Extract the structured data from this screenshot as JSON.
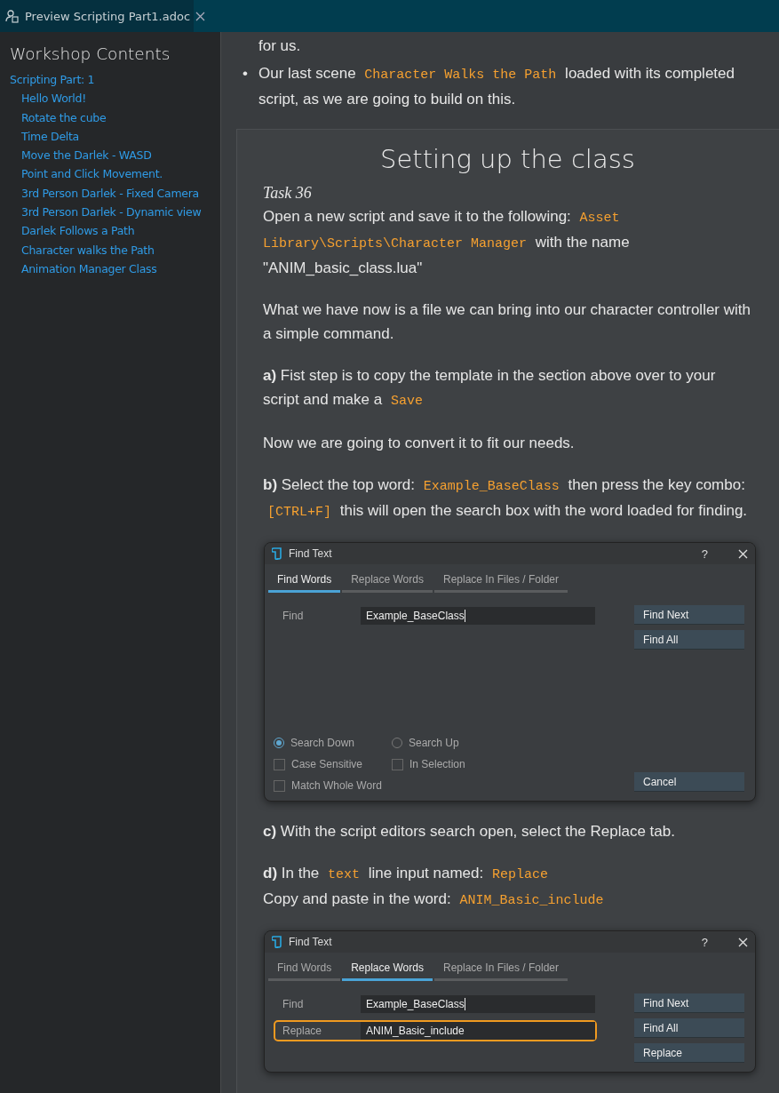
{
  "tab": {
    "title": "Preview Scripting Part1.adoc"
  },
  "sidebar": {
    "title": "Workshop Contents",
    "items": [
      {
        "label": "Scripting Part: 1",
        "children": [
          {
            "label": "Hello World!"
          },
          {
            "label": "Rotate the cube"
          },
          {
            "label": "Time Delta"
          },
          {
            "label": "Move the Darlek - WASD"
          },
          {
            "label": "Point and Click Movement."
          },
          {
            "label": "3rd Person Darlek - Fixed Camera"
          },
          {
            "label": "3rd Person Darlek - Dynamic view"
          },
          {
            "label": "Darlek Follows a Path"
          },
          {
            "label": "Character walks the Path"
          },
          {
            "label": "Animation Manager Class"
          }
        ]
      }
    ]
  },
  "intro_text": "for us.",
  "bullets": [
    {
      "marker": "•",
      "segments": [
        {
          "kind": "text",
          "text": "Our last scene "
        },
        {
          "kind": "code",
          "text": "Character Walks the Path"
        },
        {
          "kind": "text",
          "text": " loaded with its completed script, as we are going to build on this."
        }
      ]
    }
  ],
  "section": {
    "title": "Setting up the class",
    "task_label": "Task 36",
    "blocks": [
      {
        "kind": "paragraph",
        "segments": [
          {
            "kind": "text",
            "text": "Open a new script and save it to the following: "
          },
          {
            "kind": "code",
            "text": "Asset Library\\Scripts\\Character Manager"
          },
          {
            "kind": "text",
            "text": " with the name \"ANIM_basic_class.lua\""
          }
        ]
      },
      {
        "kind": "paragraph",
        "segments": [
          {
            "kind": "text",
            "text": "What we have now is a file we can bring into our character controller with a simple command."
          }
        ]
      },
      {
        "kind": "paragraph",
        "segments": [
          {
            "kind": "text",
            "text": "**a)** Fist step is to copy the template in the section above over to your script and make a "
          },
          {
            "kind": "code",
            "text": "Save"
          }
        ]
      },
      {
        "kind": "paragraph",
        "segments": [
          {
            "kind": "text",
            "text": "Now we are going to convert it to fit our needs."
          }
        ]
      },
      {
        "kind": "paragraph",
        "segments": [
          {
            "kind": "text",
            "text": "**b)** Select the top word: "
          },
          {
            "kind": "code",
            "text": "Example_BaseClass"
          },
          {
            "kind": "text",
            "text": " then press the key combo: "
          },
          {
            "kind": "code",
            "text": "[CTRL+F]"
          },
          {
            "kind": "text",
            "text": " this will open the search box with the word loaded for finding."
          }
        ]
      },
      {
        "kind": "dialog",
        "title": "Find Text",
        "help": "?",
        "tabs": [
          {
            "label": "Find Words",
            "selected": true
          },
          {
            "label": "Replace Words",
            "selected": false
          },
          {
            "label": "Replace In Files / Folder",
            "selected": false
          }
        ],
        "fields": [
          {
            "label": "Find",
            "value": "Example_BaseClass",
            "highlighted": false,
            "caret": true
          }
        ],
        "buttons": [
          "Find Next",
          "Find All"
        ],
        "options": [
          {
            "kind": "radio",
            "label": "Search Down",
            "checked": true
          },
          {
            "kind": "radio",
            "label": "Search Up",
            "checked": false
          },
          {
            "kind": "checkbox",
            "label": "Case Sensitive",
            "checked": false
          },
          {
            "kind": "checkbox",
            "label": "In Selection",
            "checked": false
          },
          {
            "kind": "checkbox",
            "label": "Match Whole Word",
            "checked": false
          }
        ],
        "footer_button": "Cancel"
      },
      {
        "kind": "paragraph",
        "segments": [
          {
            "kind": "text",
            "text": "**c)** With the script editors search open, select the Replace tab."
          }
        ]
      },
      {
        "kind": "paragraph",
        "segments": [
          {
            "kind": "text",
            "text": "**d)** In the "
          },
          {
            "kind": "code",
            "text": "text"
          },
          {
            "kind": "text",
            "text": " line input named: "
          },
          {
            "kind": "code",
            "text": "Replace"
          },
          {
            "kind": "break"
          },
          {
            "kind": "text",
            "text": "Copy and paste in the word: "
          },
          {
            "kind": "code",
            "text": "ANIM_Basic_include"
          }
        ]
      },
      {
        "kind": "dialog",
        "title": "Find Text",
        "help": "?",
        "tabs": [
          {
            "label": "Find Words",
            "selected": false
          },
          {
            "label": "Replace Words",
            "selected": true
          },
          {
            "label": "Replace In Files / Folder",
            "selected": false
          }
        ],
        "fields": [
          {
            "label": "Find",
            "value": "Example_BaseClass",
            "highlighted": false,
            "caret": true
          },
          {
            "label": "Replace",
            "value": "ANIM_Basic_include",
            "highlighted": true,
            "caret": false
          }
        ],
        "buttons": [
          "Find Next",
          "Find All",
          "Replace"
        ]
      }
    ]
  }
}
